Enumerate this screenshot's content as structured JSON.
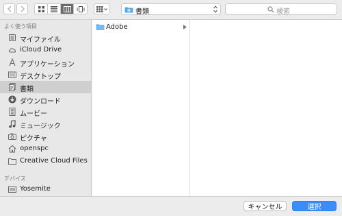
{
  "toolbar": {
    "path_label": "書類",
    "search_placeholder": "検索"
  },
  "sidebar": {
    "favorites_heading": "よく使う項目",
    "devices_heading": "デバイス",
    "items": [
      {
        "label": "マイファイル",
        "icon": "all-files-icon"
      },
      {
        "label": "iCloud Drive",
        "icon": "cloud-icon"
      },
      {
        "label": "アプリケーション",
        "icon": "applications-icon"
      },
      {
        "label": "デスクトップ",
        "icon": "desktop-icon"
      },
      {
        "label": "書類",
        "icon": "documents-icon",
        "selected": true
      },
      {
        "label": "ダウンロード",
        "icon": "download-icon"
      },
      {
        "label": "ムービー",
        "icon": "movie-icon"
      },
      {
        "label": "ミュージック",
        "icon": "music-icon"
      },
      {
        "label": "ピクチャ",
        "icon": "camera-icon"
      },
      {
        "label": "openspc",
        "icon": "home-icon"
      },
      {
        "label": "Creative Cloud Files",
        "icon": "folder-icon"
      }
    ],
    "devices": [
      {
        "label": "Yosemite",
        "icon": "disk-icon"
      }
    ]
  },
  "browser": {
    "column1": [
      {
        "label": "Adobe",
        "icon": "folder-icon",
        "has_children": true
      }
    ]
  },
  "buttons": {
    "cancel": "キャンセル",
    "ok": "選択"
  },
  "colors": {
    "accent": "#3b8ef7",
    "folder": "#5aa9e6",
    "selection": "#cfcfcf"
  }
}
